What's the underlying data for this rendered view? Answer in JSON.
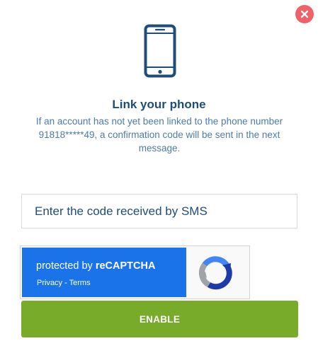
{
  "dialog": {
    "close_icon": "close-icon",
    "phone_icon": "smartphone-icon",
    "title": "Link your phone",
    "description": "If an account has not yet been linked to the phone number 91818*****49, a confirmation code will be sent in the next message.",
    "code_input": {
      "placeholder": "Enter the code received by SMS",
      "value": ""
    },
    "recaptcha": {
      "protected_prefix": "protected by ",
      "brand": "reCAPTCHA",
      "privacy_label": "Privacy",
      "separator": " - ",
      "terms_label": "Terms",
      "logo_icon": "recaptcha-logo-icon"
    },
    "enable_label": "ENABLE"
  },
  "colors": {
    "title": "#1f4d7a",
    "description": "#4d7ca8",
    "close": "#f0616a",
    "recaptcha_blue": "#1a73e8",
    "enable_button": "#77ab29"
  }
}
